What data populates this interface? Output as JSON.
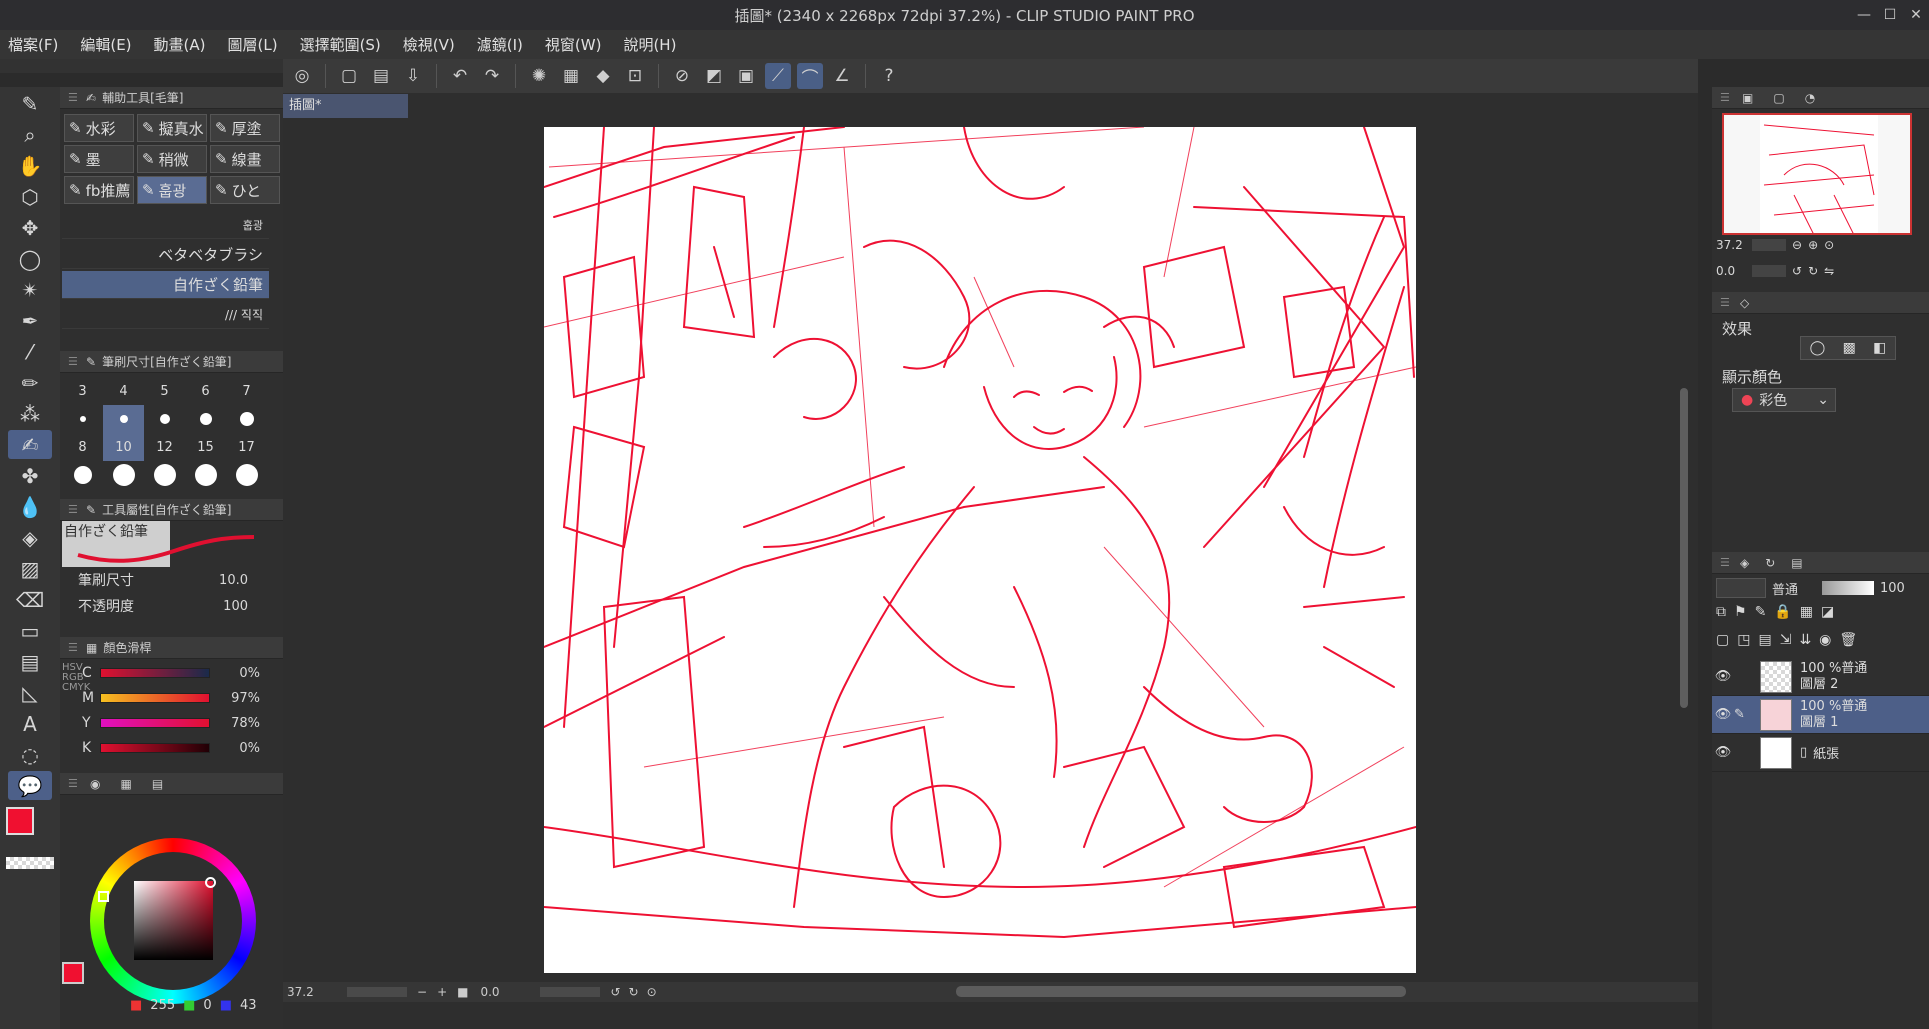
{
  "window": {
    "title": "插圖* (2340 x 2268px 72dpi 37.2%)  - CLIP STUDIO PAINT PRO",
    "controls": [
      "—",
      "☐",
      "✕"
    ]
  },
  "menu": [
    "檔案(F)",
    "編輯(E)",
    "動畫(A)",
    "圖層(L)",
    "選擇範圍(S)",
    "檢視(V)",
    "濾鏡(I)",
    "視窗(W)",
    "說明(H)"
  ],
  "document_tab": "插圖*",
  "subtool_panel": {
    "title": "輔助工具[毛筆]",
    "items": [
      "水彩",
      "擬真水",
      "厚塗",
      "墨",
      "稍微",
      "線畫",
      "fb推薦",
      "훕광",
      "ひと"
    ],
    "selected": "훕광"
  },
  "brush_list": [
    "훕광",
    "ベタベタブラシ",
    "自作ざく鉛筆",
    "/// 직직"
  ],
  "brush_size_panel": {
    "title": "筆刷尺寸[自作ざく鉛筆]",
    "sizes_row1": [
      "3",
      "4",
      "5",
      "6",
      "7"
    ],
    "sizes_row2": [
      "8",
      "10",
      "12",
      "15",
      "17"
    ],
    "selected": "10"
  },
  "tool_property": {
    "title": "工具屬性[自作ざく鉛筆]",
    "brush_name": "自作ざく鉛筆",
    "size_label": "筆刷尺寸",
    "size_value": "10.0",
    "opacity_label": "不透明度",
    "opacity_value": "100"
  },
  "color_slider": {
    "title": "顏色滑桿",
    "mode_tabs": [
      "HSV",
      "RGB",
      "CMYK"
    ],
    "channels": [
      {
        "label": "C",
        "value": "0%"
      },
      {
        "label": "M",
        "value": "97%"
      },
      {
        "label": "Y",
        "value": "78%"
      },
      {
        "label": "K",
        "value": "0%"
      }
    ]
  },
  "color_wheel": {
    "r": "255",
    "g": "0",
    "b": "43",
    "main_color": "#f01030"
  },
  "status": {
    "zoom": "37.2",
    "rotation": "0.0"
  },
  "navigator": {
    "zoom": "37.2",
    "rotation": "0.0"
  },
  "layer_property": {
    "effect_label": "效果",
    "display_color_label": "顯示顏色",
    "display_color_value": "彩色"
  },
  "layers_panel": {
    "blend_mode": "普通",
    "opacity": "100",
    "layers": [
      {
        "info": "100 %普通",
        "name": "圖層 2",
        "selected": false
      },
      {
        "info": "100 %普通",
        "name": "圖層 1",
        "selected": true
      },
      {
        "info": "",
        "name": "紙張",
        "selected": false
      }
    ]
  },
  "colors": {
    "accent": "#4d6089",
    "sketch_red": "#ee1133"
  }
}
